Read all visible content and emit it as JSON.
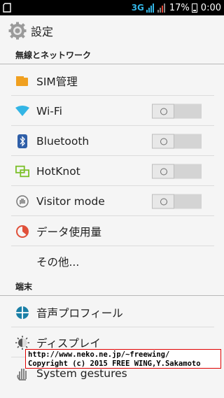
{
  "status_bar": {
    "network": "3G",
    "battery": "17%",
    "time": "0:00"
  },
  "header": {
    "title": "設定",
    "icon": "settings-gear-icon"
  },
  "sections": [
    {
      "title": "無線とネットワーク",
      "items": [
        {
          "label": "SIM管理",
          "icon": "sim-card-icon"
        },
        {
          "label": "Wi-Fi",
          "icon": "wifi-icon",
          "toggle": "off"
        },
        {
          "label": "Bluetooth",
          "icon": "bluetooth-icon",
          "toggle": "off"
        },
        {
          "label": "HotKnot",
          "icon": "hotknot-icon",
          "toggle": "off"
        },
        {
          "label": "Visitor mode",
          "icon": "visitor-hand-icon",
          "toggle": "off"
        },
        {
          "label": "データ使用量",
          "icon": "data-usage-icon"
        },
        {
          "label": "その他...",
          "icon": ""
        }
      ]
    },
    {
      "title": "端末",
      "items": [
        {
          "label": "音声プロフィール",
          "icon": "audio-profile-icon"
        },
        {
          "label": "ディスプレイ",
          "icon": "display-brightness-icon"
        },
        {
          "label": "System gestures",
          "icon": "gesture-hand-icon"
        }
      ]
    }
  ],
  "watermark": {
    "line1": "http://www.neko.ne.jp/~freewing/",
    "line2": "Copyright (c) 2015 FREE WING,Y.Sakamoto"
  },
  "colors": {
    "accent": "#33b5e5",
    "sim": "#f0a020",
    "hotknot": "#7cc02a",
    "data_usage": "#e0503a",
    "audio": "#1a7fa6",
    "bluetooth": "#2f5fa8",
    "watermark_border": "#e00000"
  }
}
